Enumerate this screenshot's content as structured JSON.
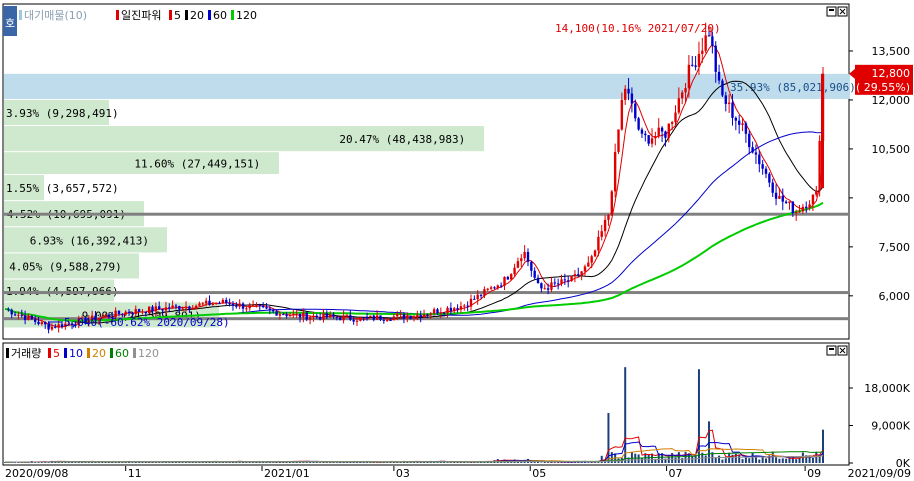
{
  "price_panel": {
    "legend": [
      {
        "label": "대기매물(10)",
        "color": "#9ec8e0"
      },
      {
        "label": "일진파워",
        "color": "#e00000"
      },
      {
        "label": "5",
        "color": "#e00000"
      },
      {
        "label": "20",
        "color": "#000000"
      },
      {
        "label": "60",
        "color": "#0000cc"
      },
      {
        "label": "120",
        "color": "#00cc00"
      }
    ],
    "side_button": "호",
    "high_annotation": "14,100(10.16% 2021/07/20)",
    "low_annotation": "5,040(-60.62% 2020/09/28)",
    "current_price": "12,800",
    "current_change": "( 29.55%)",
    "y_ticks": [
      "13,500",
      "12,000",
      "10,500",
      "9,000",
      "7,500",
      "6,000"
    ]
  },
  "volume_panel": {
    "legend": [
      {
        "label": "거래량",
        "color": "#000000"
      },
      {
        "label": "5",
        "color": "#e00000"
      },
      {
        "label": "10",
        "color": "#0000cc"
      },
      {
        "label": "20",
        "color": "#d08000"
      },
      {
        "label": "60",
        "color": "#008000"
      },
      {
        "label": "120",
        "color": "#909090"
      }
    ],
    "y_ticks": [
      "18,000K",
      "9,000K",
      "0K"
    ]
  },
  "x_axis": {
    "start_label": "2020/09/08",
    "end_label": "2021/09/09",
    "month_labels": [
      "11",
      "2021/01",
      "03",
      "05",
      "07",
      "09"
    ]
  },
  "chart_data": {
    "type": "bar",
    "title": "일진파워",
    "series": [
      {
        "name": "대기매물(10)",
        "bands": [
          {
            "percent_label": "35.93% (85,021,906)",
            "price_range": [
              12000,
              12800
            ]
          },
          {
            "percent_label": "3.93% (9,298,491)",
            "price_range": [
              11200,
              12000
            ]
          },
          {
            "percent_label": "20.47% (48,438,983)",
            "price_range": [
              10400,
              11200
            ]
          },
          {
            "percent_label": "11.60% (27,449,151)",
            "price_range": [
              9700,
              10400
            ]
          },
          {
            "percent_label": "1.55% (3,657,572)",
            "price_range": [
              8900,
              9700
            ]
          },
          {
            "percent_label": "4.52% (10,695,091)",
            "price_range": [
              8100,
              8900
            ]
          },
          {
            "percent_label": "6.93% (16,392,413)",
            "price_range": [
              7300,
              8100
            ]
          },
          {
            "percent_label": "4.05% (9,588,279)",
            "price_range": [
              6500,
              7300
            ]
          },
          {
            "percent_label": "1.94% (4,597,966)",
            "price_range": [
              5800,
              6500
            ]
          },
          {
            "percent_label": "9.09% (21,509,891)",
            "price_range": [
              5000,
              5800
            ]
          }
        ]
      }
    ],
    "price_ylim": [
      4800,
      15000
    ],
    "support_lines": [
      8500,
      6100,
      5300
    ],
    "price_path": [
      {
        "date": "2020/09/08",
        "close": 5600
      },
      {
        "date": "2020/09/28",
        "close": 5040
      },
      {
        "date": "2020/11/01",
        "close": 5500
      },
      {
        "date": "2020/12/15",
        "close": 5800
      },
      {
        "date": "2021/01/15",
        "close": 5400
      },
      {
        "date": "2021/02/15",
        "close": 5300
      },
      {
        "date": "2021/03/10",
        "close": 5400
      },
      {
        "date": "2021/04/01",
        "close": 5700
      },
      {
        "date": "2021/04/20",
        "close": 6500
      },
      {
        "date": "2021/04/28",
        "close": 7400
      },
      {
        "date": "2021/05/05",
        "close": 6200
      },
      {
        "date": "2021/05/20",
        "close": 6500
      },
      {
        "date": "2021/05/28",
        "close": 7000
      },
      {
        "date": "2021/06/05",
        "close": 8500
      },
      {
        "date": "2021/06/12",
        "close": 12500
      },
      {
        "date": "2021/06/20",
        "close": 10800
      },
      {
        "date": "2021/07/01",
        "close": 11000
      },
      {
        "date": "2021/07/10",
        "close": 12700
      },
      {
        "date": "2021/07/20",
        "close": 14100
      },
      {
        "date": "2021/07/25",
        "close": 12200
      },
      {
        "date": "2021/08/05",
        "close": 11000
      },
      {
        "date": "2021/08/20",
        "close": 9000
      },
      {
        "date": "2021/08/28",
        "close": 8600
      },
      {
        "date": "2021/09/06",
        "close": 9100
      },
      {
        "date": "2021/09/09",
        "close": 12800
      }
    ],
    "volume_ylim": [
      0,
      24000
    ],
    "volume_spikes": [
      {
        "date": "2021/06/05",
        "value": 12000
      },
      {
        "date": "2021/06/12",
        "value": 23000
      },
      {
        "date": "2021/07/15",
        "value": 22500
      },
      {
        "date": "2021/07/20",
        "value": 10000
      },
      {
        "date": "2021/09/09",
        "value": 8000
      }
    ]
  }
}
